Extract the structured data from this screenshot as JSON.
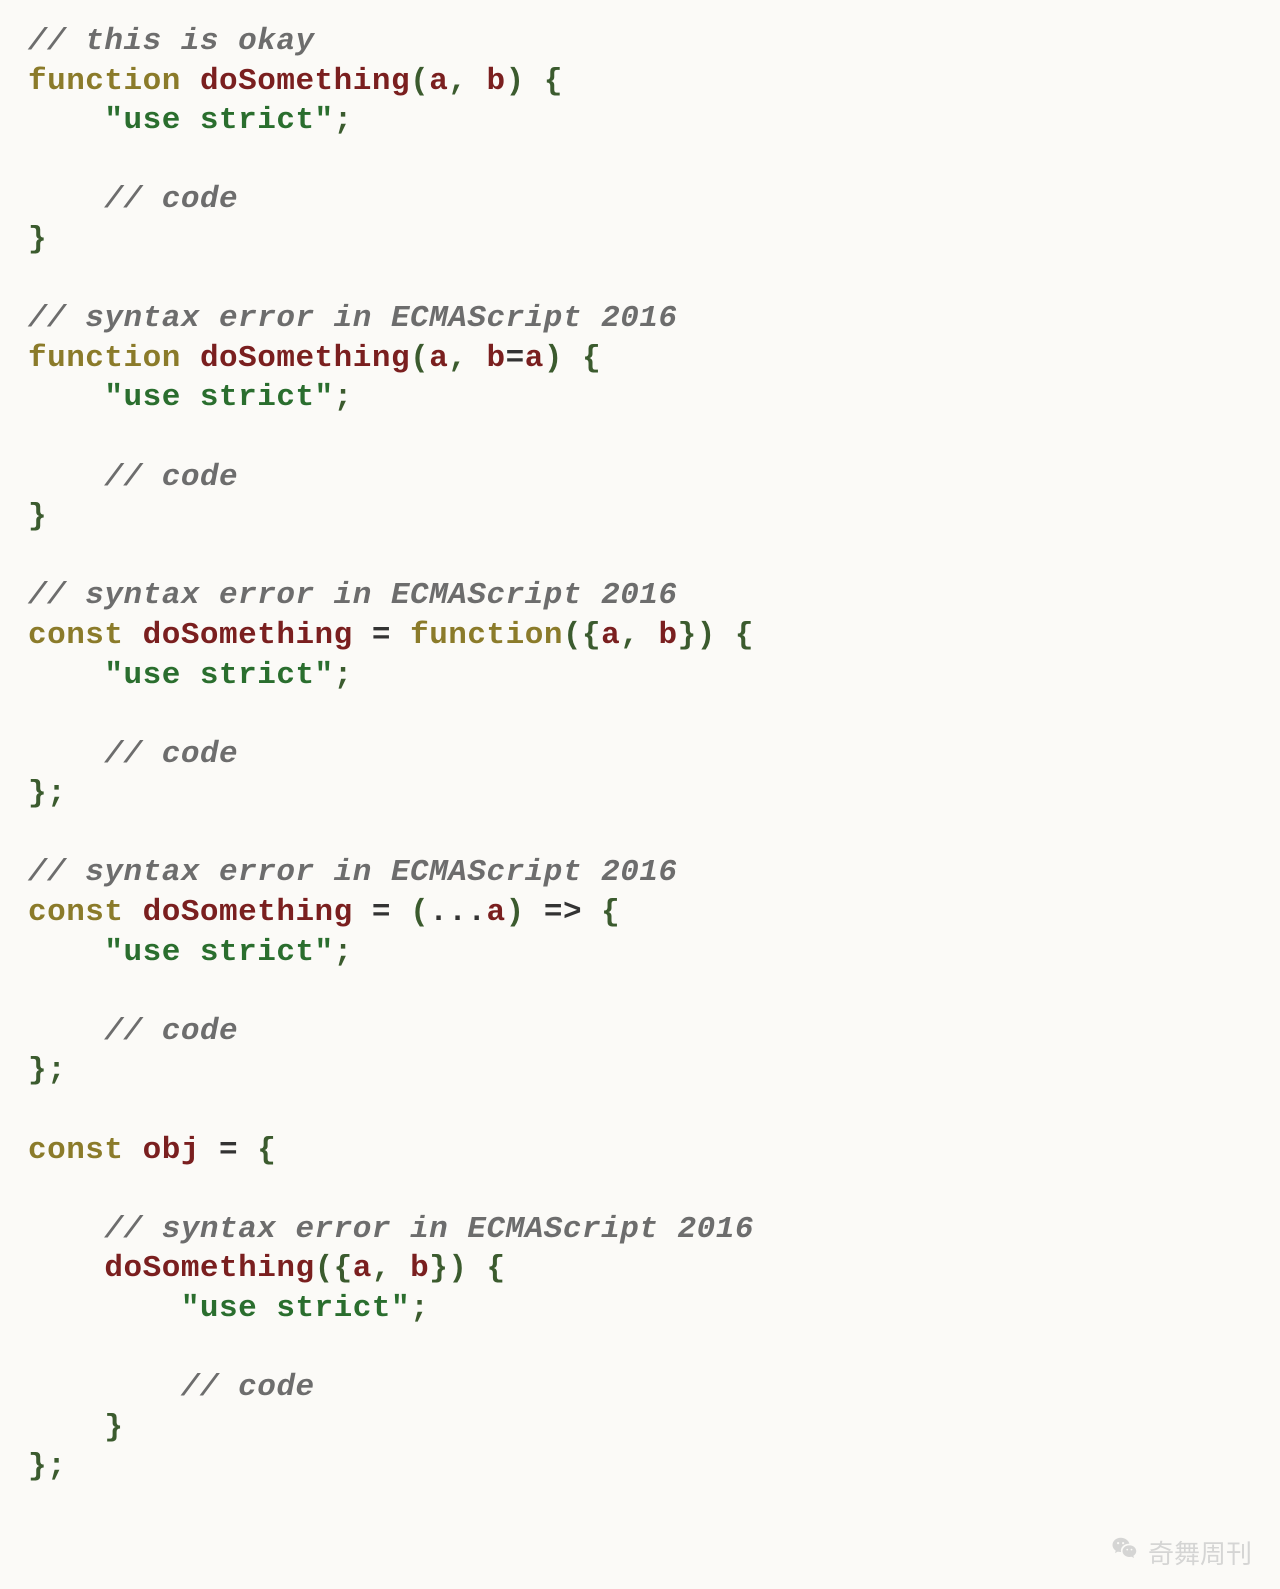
{
  "code": {
    "lines": [
      {
        "indent": 0,
        "tokens": [
          {
            "t": "cmt",
            "v": "// this is okay"
          }
        ]
      },
      {
        "indent": 0,
        "tokens": [
          {
            "t": "kw",
            "v": "function"
          },
          {
            "t": "sp"
          },
          {
            "t": "fn",
            "v": "doSomething"
          },
          {
            "t": "punc",
            "v": "("
          },
          {
            "t": "fn",
            "v": "a"
          },
          {
            "t": "punc",
            "v": ","
          },
          {
            "t": "sp"
          },
          {
            "t": "fn",
            "v": "b"
          },
          {
            "t": "punc",
            "v": ")"
          },
          {
            "t": "sp"
          },
          {
            "t": "punc",
            "v": "{"
          }
        ]
      },
      {
        "indent": 1,
        "tokens": [
          {
            "t": "str",
            "v": "\"use strict\""
          },
          {
            "t": "punc",
            "v": ";"
          }
        ]
      },
      {
        "indent": 0,
        "tokens": []
      },
      {
        "indent": 1,
        "tokens": [
          {
            "t": "cmt",
            "v": "// code"
          }
        ]
      },
      {
        "indent": 0,
        "tokens": [
          {
            "t": "punc",
            "v": "}"
          }
        ]
      },
      {
        "indent": 0,
        "tokens": []
      },
      {
        "indent": 0,
        "tokens": [
          {
            "t": "cmt",
            "v": "// syntax error in ECMAScript 2016"
          }
        ]
      },
      {
        "indent": 0,
        "tokens": [
          {
            "t": "kw",
            "v": "function"
          },
          {
            "t": "sp"
          },
          {
            "t": "fn",
            "v": "doSomething"
          },
          {
            "t": "punc",
            "v": "("
          },
          {
            "t": "fn",
            "v": "a"
          },
          {
            "t": "punc",
            "v": ","
          },
          {
            "t": "sp"
          },
          {
            "t": "fn",
            "v": "b"
          },
          {
            "t": "op",
            "v": "="
          },
          {
            "t": "fn",
            "v": "a"
          },
          {
            "t": "punc",
            "v": ")"
          },
          {
            "t": "sp"
          },
          {
            "t": "punc",
            "v": "{"
          }
        ]
      },
      {
        "indent": 1,
        "tokens": [
          {
            "t": "str",
            "v": "\"use strict\""
          },
          {
            "t": "punc",
            "v": ";"
          }
        ]
      },
      {
        "indent": 0,
        "tokens": []
      },
      {
        "indent": 1,
        "tokens": [
          {
            "t": "cmt",
            "v": "// code"
          }
        ]
      },
      {
        "indent": 0,
        "tokens": [
          {
            "t": "punc",
            "v": "}"
          }
        ]
      },
      {
        "indent": 0,
        "tokens": []
      },
      {
        "indent": 0,
        "tokens": [
          {
            "t": "cmt",
            "v": "// syntax error in ECMAScript 2016"
          }
        ]
      },
      {
        "indent": 0,
        "tokens": [
          {
            "t": "kw",
            "v": "const"
          },
          {
            "t": "sp"
          },
          {
            "t": "fn",
            "v": "doSomething"
          },
          {
            "t": "sp"
          },
          {
            "t": "op",
            "v": "="
          },
          {
            "t": "sp"
          },
          {
            "t": "kw",
            "v": "function"
          },
          {
            "t": "punc",
            "v": "("
          },
          {
            "t": "punc",
            "v": "{"
          },
          {
            "t": "fn",
            "v": "a"
          },
          {
            "t": "punc",
            "v": ","
          },
          {
            "t": "sp"
          },
          {
            "t": "fn",
            "v": "b"
          },
          {
            "t": "punc",
            "v": "}"
          },
          {
            "t": "punc",
            "v": ")"
          },
          {
            "t": "sp"
          },
          {
            "t": "punc",
            "v": "{"
          }
        ]
      },
      {
        "indent": 1,
        "tokens": [
          {
            "t": "str",
            "v": "\"use strict\""
          },
          {
            "t": "punc",
            "v": ";"
          }
        ]
      },
      {
        "indent": 0,
        "tokens": []
      },
      {
        "indent": 1,
        "tokens": [
          {
            "t": "cmt",
            "v": "// code"
          }
        ]
      },
      {
        "indent": 0,
        "tokens": [
          {
            "t": "punc",
            "v": "}"
          },
          {
            "t": "punc",
            "v": ";"
          }
        ]
      },
      {
        "indent": 0,
        "tokens": []
      },
      {
        "indent": 0,
        "tokens": [
          {
            "t": "cmt",
            "v": "// syntax error in ECMAScript 2016"
          }
        ]
      },
      {
        "indent": 0,
        "tokens": [
          {
            "t": "kw",
            "v": "const"
          },
          {
            "t": "sp"
          },
          {
            "t": "fn",
            "v": "doSomething"
          },
          {
            "t": "sp"
          },
          {
            "t": "op",
            "v": "="
          },
          {
            "t": "sp"
          },
          {
            "t": "punc",
            "v": "("
          },
          {
            "t": "op",
            "v": "..."
          },
          {
            "t": "fn",
            "v": "a"
          },
          {
            "t": "punc",
            "v": ")"
          },
          {
            "t": "sp"
          },
          {
            "t": "op",
            "v": "=>"
          },
          {
            "t": "sp"
          },
          {
            "t": "punc",
            "v": "{"
          }
        ]
      },
      {
        "indent": 1,
        "tokens": [
          {
            "t": "str",
            "v": "\"use strict\""
          },
          {
            "t": "punc",
            "v": ";"
          }
        ]
      },
      {
        "indent": 0,
        "tokens": []
      },
      {
        "indent": 1,
        "tokens": [
          {
            "t": "cmt",
            "v": "// code"
          }
        ]
      },
      {
        "indent": 0,
        "tokens": [
          {
            "t": "punc",
            "v": "}"
          },
          {
            "t": "punc",
            "v": ";"
          }
        ]
      },
      {
        "indent": 0,
        "tokens": []
      },
      {
        "indent": 0,
        "tokens": [
          {
            "t": "kw",
            "v": "const"
          },
          {
            "t": "sp"
          },
          {
            "t": "fn",
            "v": "obj"
          },
          {
            "t": "sp"
          },
          {
            "t": "op",
            "v": "="
          },
          {
            "t": "sp"
          },
          {
            "t": "punc",
            "v": "{"
          }
        ]
      },
      {
        "indent": 0,
        "tokens": []
      },
      {
        "indent": 1,
        "tokens": [
          {
            "t": "cmt",
            "v": "// syntax error in ECMAScript 2016"
          }
        ]
      },
      {
        "indent": 1,
        "tokens": [
          {
            "t": "fn",
            "v": "doSomething"
          },
          {
            "t": "punc",
            "v": "("
          },
          {
            "t": "punc",
            "v": "{"
          },
          {
            "t": "fn",
            "v": "a"
          },
          {
            "t": "punc",
            "v": ","
          },
          {
            "t": "sp"
          },
          {
            "t": "fn",
            "v": "b"
          },
          {
            "t": "punc",
            "v": "}"
          },
          {
            "t": "punc",
            "v": ")"
          },
          {
            "t": "sp"
          },
          {
            "t": "punc",
            "v": "{"
          }
        ]
      },
      {
        "indent": 2,
        "tokens": [
          {
            "t": "str",
            "v": "\"use strict\""
          },
          {
            "t": "punc",
            "v": ";"
          }
        ]
      },
      {
        "indent": 0,
        "tokens": []
      },
      {
        "indent": 2,
        "tokens": [
          {
            "t": "cmt",
            "v": "// code"
          }
        ]
      },
      {
        "indent": 1,
        "tokens": [
          {
            "t": "punc",
            "v": "}"
          }
        ]
      },
      {
        "indent": 0,
        "tokens": [
          {
            "t": "punc",
            "v": "}"
          },
          {
            "t": "punc",
            "v": ";"
          }
        ]
      }
    ]
  },
  "watermark": {
    "text": "奇舞周刊"
  }
}
